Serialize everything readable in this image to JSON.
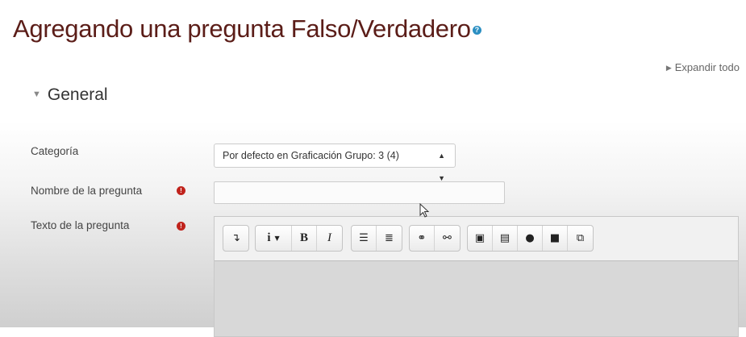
{
  "header": {
    "title": "Agregando una pregunta Falso/Verdadero",
    "help_icon": "question-circle-icon"
  },
  "expand_all": {
    "label": "Expandir todo"
  },
  "section": {
    "title": "General",
    "expanded": true
  },
  "fields": {
    "category": {
      "label": "Categoría",
      "value": "Por defecto en Graficación Grupo: 3 (4)"
    },
    "question_name": {
      "label": "Nombre de la pregunta",
      "value": "",
      "required_icon": "exclamation-circle-icon"
    },
    "question_text": {
      "label": "Texto de la pregunta",
      "required_icon": "exclamation-circle-icon"
    }
  },
  "editor_toolbar": {
    "groups": [
      [
        "collapse-icon"
      ],
      [
        "info-dropdown-icon",
        "bold-icon",
        "italic-icon"
      ],
      [
        "unordered-list-icon",
        "ordered-list-icon"
      ],
      [
        "link-icon",
        "unlink-icon"
      ],
      [
        "image-icon",
        "media-icon",
        "record-audio-icon",
        "record-video-icon",
        "manage-files-icon"
      ]
    ]
  },
  "colors": {
    "title": "#5b1d18",
    "required": "#c0231c",
    "help": "#2b8fc2"
  }
}
